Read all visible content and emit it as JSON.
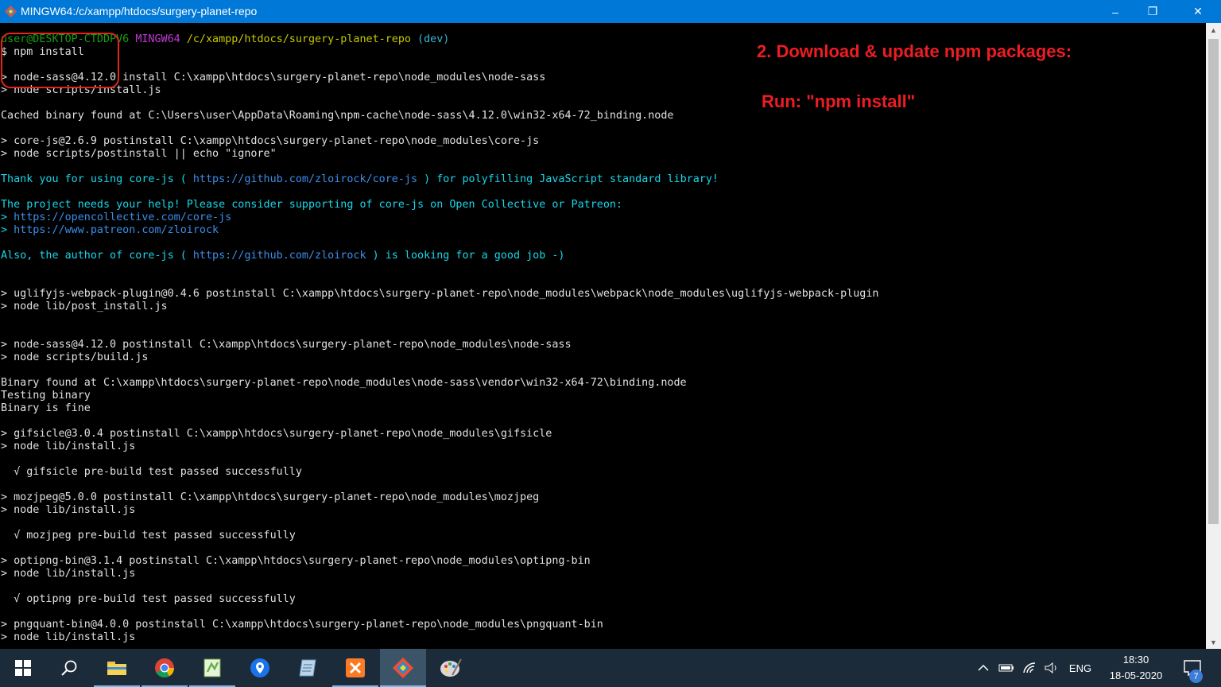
{
  "window": {
    "title": "MINGW64:/c/xampp/htdocs/surgery-planet-repo",
    "minimize": "–",
    "maximize": "❐",
    "close": "✕"
  },
  "terminal": {
    "prompt_user": "user@DESKTOP-CTDDPV6",
    "prompt_env": "MINGW64",
    "prompt_path": "/c/xampp/htdocs/surgery-planet-repo",
    "prompt_branch": "(dev)",
    "command": "$ npm install",
    "lines": [
      "> node-sass@4.12.0 install C:\\xampp\\htdocs\\surgery-planet-repo\\node_modules\\node-sass",
      "> node scripts/install.js",
      "Cached binary found at C:\\Users\\user\\AppData\\Roaming\\npm-cache\\node-sass\\4.12.0\\win32-x64-72_binding.node",
      "> core-js@2.6.9 postinstall C:\\xampp\\htdocs\\surgery-planet-repo\\node_modules\\core-js",
      "> node scripts/postinstall || echo \"ignore\"",
      "> uglifyjs-webpack-plugin@0.4.6 postinstall C:\\xampp\\htdocs\\surgery-planet-repo\\node_modules\\webpack\\node_modules\\uglifyjs-webpack-plugin",
      "> node lib/post_install.js",
      "> node-sass@4.12.0 postinstall C:\\xampp\\htdocs\\surgery-planet-repo\\node_modules\\node-sass",
      "> node scripts/build.js",
      "Binary found at C:\\xampp\\htdocs\\surgery-planet-repo\\node_modules\\node-sass\\vendor\\win32-x64-72\\binding.node",
      "Testing binary",
      "Binary is fine",
      "> gifsicle@3.0.4 postinstall C:\\xampp\\htdocs\\surgery-planet-repo\\node_modules\\gifsicle",
      "> node lib/install.js",
      "  √ gifsicle pre-build test passed successfully",
      "> mozjpeg@5.0.0 postinstall C:\\xampp\\htdocs\\surgery-planet-repo\\node_modules\\mozjpeg",
      "> node lib/install.js",
      "  √ mozjpeg pre-build test passed successfully",
      "> optipng-bin@3.1.4 postinstall C:\\xampp\\htdocs\\surgery-planet-repo\\node_modules\\optipng-bin",
      "> node lib/install.js",
      "  √ optipng pre-build test passed successfully",
      "> pngquant-bin@4.0.0 postinstall C:\\xampp\\htdocs\\surgery-planet-repo\\node_modules\\pngquant-bin",
      "> node lib/install.js"
    ],
    "corejs": {
      "thanks_a": "Thank you for using core-js ( ",
      "thanks_link": "https://github.com/zloirock/core-js",
      "thanks_b": " ) for polyfilling JavaScript standard library!",
      "needs_help": "The project needs your help! Please consider supporting of core-js on Open Collective or Patreon:",
      "link1": "https://opencollective.com/core-js",
      "link2": "https://www.patreon.com/zloirock",
      "arrow": "> ",
      "author_a": "Also, the author of core-js ( ",
      "author_link": "https://github.com/zloirock",
      "author_b": " ) is looking for a good job -)"
    }
  },
  "annotations": {
    "heading": "2. Download & update npm packages:",
    "run": "Run: \"npm install\""
  },
  "taskbar": {
    "language": "ENG",
    "time": "18:30",
    "date": "18-05-2020",
    "notification_count": "7"
  },
  "colors": {
    "titlebar": "#0078d7",
    "taskbar": "#1b2b3a",
    "annotation": "#ee1d23"
  }
}
